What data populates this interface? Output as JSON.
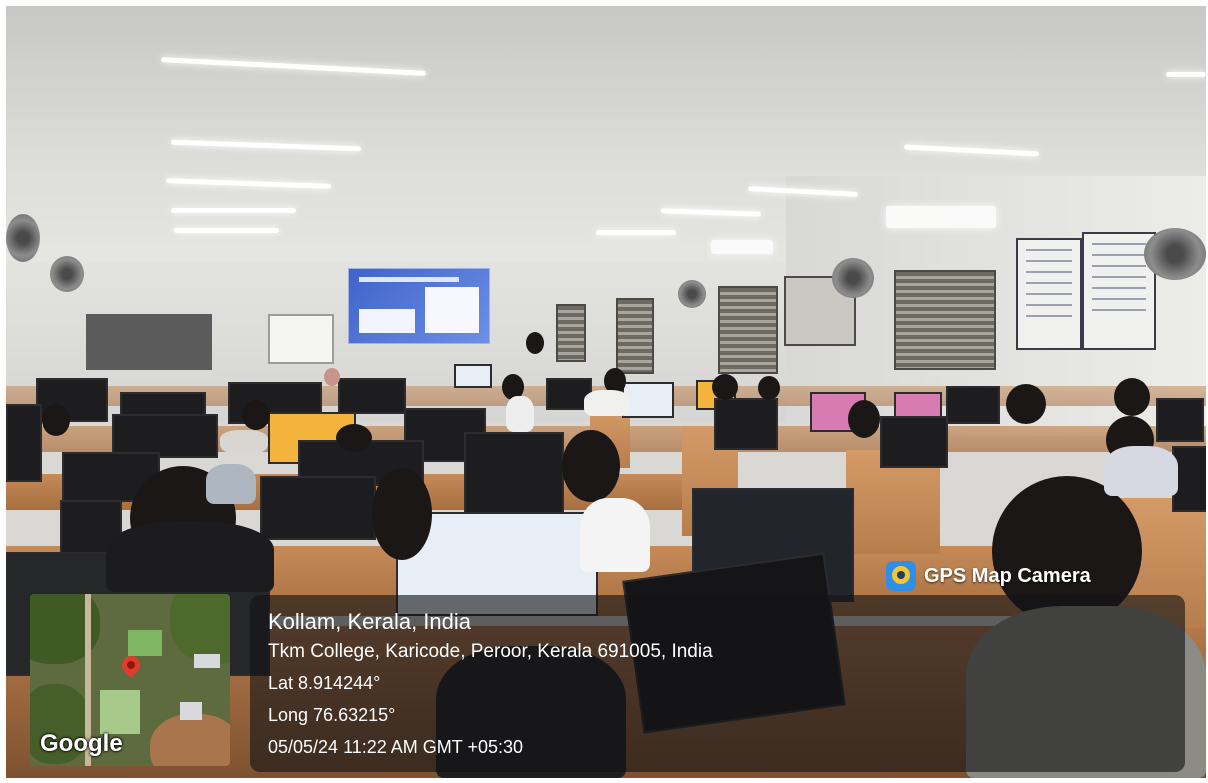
{
  "overlay": {
    "app_name": "GPS Map Camera",
    "location": "Kollam, Kerala, India",
    "address": "Tkm College, Karicode, Peroor, Kerala 691005, India",
    "latitude": "Lat 8.914244°",
    "longitude": "Long 76.63215°",
    "datetime": "05/05/24 11:22 AM GMT +05:30",
    "map_watermark": "Google",
    "icons": [
      "gps-map-camera-logo-icon",
      "map-pin-icon"
    ]
  }
}
